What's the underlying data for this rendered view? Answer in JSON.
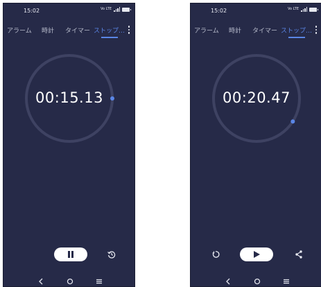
{
  "screens": [
    {
      "status_time": "15:02",
      "status_signal_text": "Vo LTE",
      "tabs": [
        {
          "label": "アラーム"
        },
        {
          "label": "時計"
        },
        {
          "label": "タイマー"
        },
        {
          "label": "ストップ…"
        }
      ],
      "active_tab": 3,
      "stopwatch_time": "00:15.13",
      "state": "running",
      "primary_button_icon": "pause-icon",
      "right_button_icon": "lap-history-icon",
      "elapsed_fraction": 0.25
    },
    {
      "status_time": "15:02",
      "status_signal_text": "Vo LTE",
      "tabs": [
        {
          "label": "アラーム"
        },
        {
          "label": "時計"
        },
        {
          "label": "タイマー"
        },
        {
          "label": "ストップ…"
        }
      ],
      "active_tab": 3,
      "stopwatch_time": "00:20.47",
      "state": "paused",
      "primary_button_icon": "play-icon",
      "left_button_icon": "reset-icon",
      "right_button_icon": "share-icon",
      "elapsed_fraction": 0.34
    }
  ],
  "nav_bar_icons": [
    "back-icon",
    "home-icon",
    "recents-icon"
  ],
  "colors": {
    "background": "#262a48",
    "accent": "#5a86e6",
    "ring": "#3e4262",
    "text": "#ffffff"
  }
}
